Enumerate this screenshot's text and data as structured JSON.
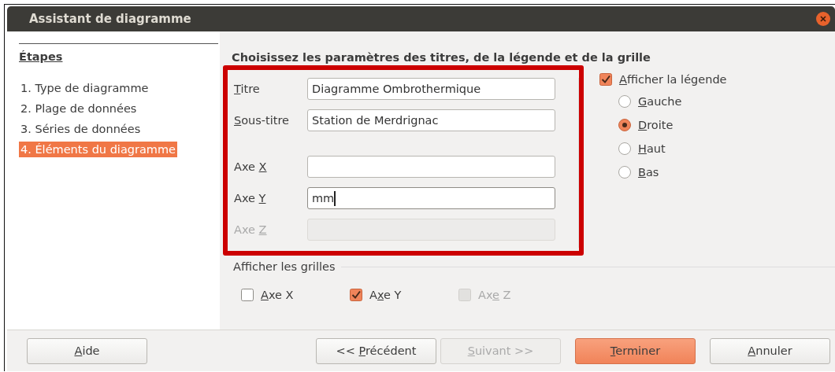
{
  "window": {
    "title": "Assistant de diagramme"
  },
  "sidebar": {
    "heading": "Étapes",
    "items": [
      {
        "label": "1. Type de diagramme",
        "selected": false
      },
      {
        "label": "2. Plage de données",
        "selected": false
      },
      {
        "label": "3. Séries de données",
        "selected": false
      },
      {
        "label": "4. Éléments du diagramme",
        "selected": true
      }
    ]
  },
  "heading": "Choisissez les paramètres des titres, de la légende et de la grille",
  "titles": [
    {
      "label": [
        {
          "text": "T",
          "underline": true
        },
        {
          "text": "itre",
          "underline": false
        }
      ],
      "value": "Diagramme Ombrothermique",
      "disabled": false,
      "focused": false
    },
    {
      "label": [
        {
          "text": "S",
          "underline": true
        },
        {
          "text": "ous-titre",
          "underline": false
        }
      ],
      "value": "Station de Merdrignac",
      "disabled": false,
      "focused": false
    },
    {
      "label": [
        {
          "text": "Axe ",
          "underline": false
        },
        {
          "text": "X",
          "underline": true
        }
      ],
      "disabled": false,
      "focused": false
    },
    {
      "label": [
        {
          "text": "Axe ",
          "underline": false
        },
        {
          "text": "Y",
          "underline": true
        }
      ],
      "value": "mm",
      "disabled": false,
      "focused": true
    },
    {
      "label": [
        {
          "text": "Axe ",
          "underline": false
        },
        {
          "text": "Z",
          "underline": true
        }
      ],
      "disabled": true,
      "focused": false
    }
  ],
  "legend": {
    "checked": true,
    "label": [
      {
        "text": "A",
        "underline": true
      },
      {
        "text": "fficher la légende",
        "underline": false
      }
    ],
    "positions": [
      {
        "label": [
          {
            "text": "G",
            "underline": true
          },
          {
            "text": "auche",
            "underline": false
          }
        ],
        "selected": false
      },
      {
        "label": [
          {
            "text": "D",
            "underline": true
          },
          {
            "text": "roite",
            "underline": false
          }
        ],
        "selected": true
      },
      {
        "label": [
          {
            "text": "H",
            "underline": true
          },
          {
            "text": "aut",
            "underline": false
          }
        ],
        "selected": false
      },
      {
        "label": [
          {
            "text": "B",
            "underline": true
          },
          {
            "text": "as",
            "underline": false
          }
        ],
        "selected": false
      }
    ]
  },
  "grids": {
    "title": "Afficher les grilles",
    "items": [
      {
        "label": [
          {
            "text": "A",
            "underline": true
          },
          {
            "text": "xe X",
            "underline": false
          }
        ],
        "checked": false,
        "disabled": false
      },
      {
        "label": [
          {
            "text": "A",
            "underline": false
          },
          {
            "text": "x",
            "underline": true
          },
          {
            "text": "e Y",
            "underline": false
          }
        ],
        "checked": true,
        "disabled": false
      },
      {
        "label": [
          {
            "text": "Ax",
            "underline": false
          },
          {
            "text": "e",
            "underline": true
          },
          {
            "text": " Z",
            "underline": false
          }
        ],
        "checked": false,
        "disabled": true
      }
    ]
  },
  "buttons": [
    {
      "label": [
        {
          "text": "A",
          "underline": true
        },
        {
          "text": "ide",
          "underline": false
        }
      ],
      "disabled": false,
      "default": false
    },
    {
      "label": [
        {
          "text": "<< ",
          "underline": false
        },
        {
          "text": "P",
          "underline": true
        },
        {
          "text": "récédent",
          "underline": false
        }
      ],
      "disabled": false,
      "default": false
    },
    {
      "label": [
        {
          "text": "S",
          "underline": true
        },
        {
          "text": "uivant >>",
          "underline": false
        }
      ],
      "disabled": true,
      "default": false
    },
    {
      "label": [
        {
          "text": "T",
          "underline": true
        },
        {
          "text": "erminer",
          "underline": false
        }
      ],
      "disabled": false,
      "default": true
    },
    {
      "label": [
        {
          "text": "A",
          "underline": true
        },
        {
          "text": "nnuler",
          "underline": false
        }
      ],
      "disabled": false,
      "default": false
    }
  ],
  "annotation": {
    "kind": "highlight"
  }
}
